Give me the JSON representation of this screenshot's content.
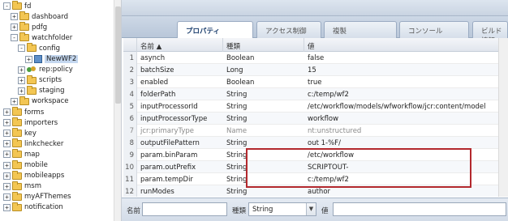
{
  "tree": {
    "items": [
      {
        "label": "fd",
        "expand": "-",
        "icon": "folder",
        "indent": 0,
        "selected": false
      },
      {
        "label": "dashboard",
        "expand": "+",
        "icon": "folder",
        "indent": 1,
        "selected": false
      },
      {
        "label": "pdfg",
        "expand": "+",
        "icon": "folder",
        "indent": 1,
        "selected": false
      },
      {
        "label": "watchfolder",
        "expand": "-",
        "icon": "folder",
        "indent": 1,
        "selected": false
      },
      {
        "label": "config",
        "expand": "-",
        "icon": "folder",
        "indent": 2,
        "selected": false
      },
      {
        "label": "NewWF2",
        "expand": "+",
        "icon": "node",
        "indent": 3,
        "selected": true
      },
      {
        "label": "rep:policy",
        "expand": "+",
        "icon": "group",
        "indent": 2,
        "selected": false
      },
      {
        "label": "scripts",
        "expand": "+",
        "icon": "folder",
        "indent": 2,
        "selected": false
      },
      {
        "label": "staging",
        "expand": "+",
        "icon": "folder",
        "indent": 2,
        "selected": false
      },
      {
        "label": "workspace",
        "expand": "+",
        "icon": "folder",
        "indent": 1,
        "selected": false
      },
      {
        "label": "forms",
        "expand": "+",
        "icon": "folder",
        "indent": 0,
        "selected": false
      },
      {
        "label": "importers",
        "expand": "+",
        "icon": "folder",
        "indent": 0,
        "selected": false
      },
      {
        "label": "key",
        "expand": "+",
        "icon": "folder",
        "indent": 0,
        "selected": false
      },
      {
        "label": "linkchecker",
        "expand": "+",
        "icon": "folder",
        "indent": 0,
        "selected": false
      },
      {
        "label": "map",
        "expand": "+",
        "icon": "folder",
        "indent": 0,
        "selected": false
      },
      {
        "label": "mobile",
        "expand": "+",
        "icon": "folder",
        "indent": 0,
        "selected": false
      },
      {
        "label": "mobileapps",
        "expand": "+",
        "icon": "folder",
        "indent": 0,
        "selected": false
      },
      {
        "label": "msm",
        "expand": "+",
        "icon": "folder",
        "indent": 0,
        "selected": false
      },
      {
        "label": "myAFThemes",
        "expand": "+",
        "icon": "folder",
        "indent": 0,
        "selected": false
      },
      {
        "label": "notification",
        "expand": "+",
        "icon": "folder",
        "indent": 0,
        "selected": false
      }
    ]
  },
  "tabs": [
    "プロパティ",
    "アクセス制御",
    "複製",
    "コンソール",
    "ビルド情報"
  ],
  "grid": {
    "headers": {
      "name": "名前 ▲",
      "type": "種類",
      "value": "値"
    },
    "rows": [
      {
        "num": "1",
        "name": "asynch",
        "type": "Boolean",
        "value": "false",
        "grey": false
      },
      {
        "num": "2",
        "name": "batchSize",
        "type": "Long",
        "value": "15",
        "grey": false
      },
      {
        "num": "3",
        "name": "enabled",
        "type": "Boolean",
        "value": "true",
        "grey": false
      },
      {
        "num": "4",
        "name": "folderPath",
        "type": "String",
        "value": "c:/temp/wf2",
        "grey": false
      },
      {
        "num": "5",
        "name": "inputProcessorId",
        "type": "String",
        "value": "/etc/workflow/models/wfworkflow/jcr:content/model",
        "grey": false
      },
      {
        "num": "6",
        "name": "inputProcessorType",
        "type": "String",
        "value": "workflow",
        "grey": false
      },
      {
        "num": "7",
        "name": "jcr:primaryType",
        "type": "Name",
        "value": "nt:unstructured",
        "grey": true
      },
      {
        "num": "8",
        "name": "outputFilePattern",
        "type": "String",
        "value": "out 1-%F/",
        "grey": false
      },
      {
        "num": "9",
        "name": "param.binParam",
        "type": "String",
        "value": "/etc/workflow",
        "grey": false
      },
      {
        "num": "10",
        "name": "param.outPrefix",
        "type": "String",
        "value": "SCRIPTOUT-",
        "grey": false
      },
      {
        "num": "11",
        "name": "param.tempDir",
        "type": "String",
        "value": "c:/temp/wf2",
        "grey": false
      },
      {
        "num": "12",
        "name": "runModes",
        "type": "String",
        "value": "author",
        "grey": false
      }
    ]
  },
  "bottom": {
    "name_label": "名前",
    "type_label": "種類",
    "type_value": "String",
    "value_label": "値"
  },
  "colors": {
    "highlight": "#b3282d",
    "selection": "#c4d7ef",
    "folder": "#f3c653"
  }
}
